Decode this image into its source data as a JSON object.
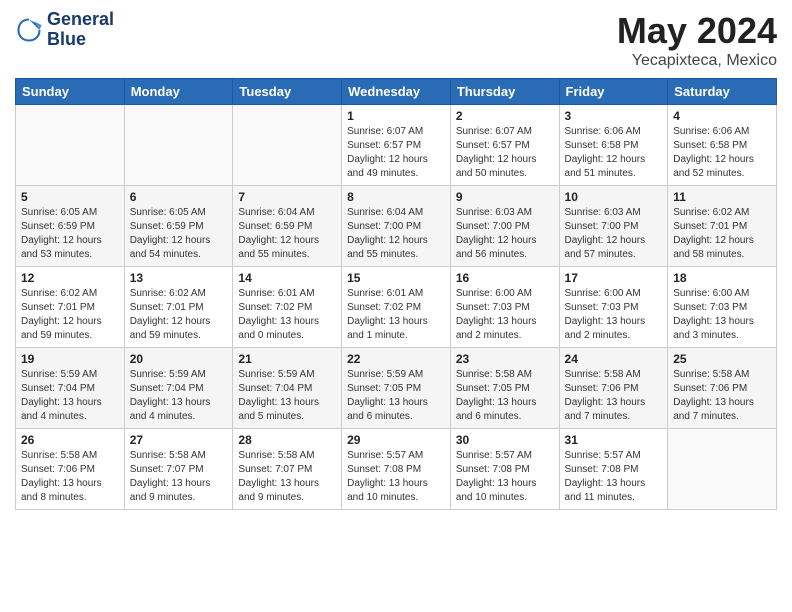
{
  "header": {
    "logo_line1": "General",
    "logo_line2": "Blue",
    "month": "May 2024",
    "location": "Yecapixteca, Mexico"
  },
  "weekdays": [
    "Sunday",
    "Monday",
    "Tuesday",
    "Wednesday",
    "Thursday",
    "Friday",
    "Saturday"
  ],
  "weeks": [
    [
      {
        "day": "",
        "info": ""
      },
      {
        "day": "",
        "info": ""
      },
      {
        "day": "",
        "info": ""
      },
      {
        "day": "1",
        "info": "Sunrise: 6:07 AM\nSunset: 6:57 PM\nDaylight: 12 hours\nand 49 minutes."
      },
      {
        "day": "2",
        "info": "Sunrise: 6:07 AM\nSunset: 6:57 PM\nDaylight: 12 hours\nand 50 minutes."
      },
      {
        "day": "3",
        "info": "Sunrise: 6:06 AM\nSunset: 6:58 PM\nDaylight: 12 hours\nand 51 minutes."
      },
      {
        "day": "4",
        "info": "Sunrise: 6:06 AM\nSunset: 6:58 PM\nDaylight: 12 hours\nand 52 minutes."
      }
    ],
    [
      {
        "day": "5",
        "info": "Sunrise: 6:05 AM\nSunset: 6:59 PM\nDaylight: 12 hours\nand 53 minutes."
      },
      {
        "day": "6",
        "info": "Sunrise: 6:05 AM\nSunset: 6:59 PM\nDaylight: 12 hours\nand 54 minutes."
      },
      {
        "day": "7",
        "info": "Sunrise: 6:04 AM\nSunset: 6:59 PM\nDaylight: 12 hours\nand 55 minutes."
      },
      {
        "day": "8",
        "info": "Sunrise: 6:04 AM\nSunset: 7:00 PM\nDaylight: 12 hours\nand 55 minutes."
      },
      {
        "day": "9",
        "info": "Sunrise: 6:03 AM\nSunset: 7:00 PM\nDaylight: 12 hours\nand 56 minutes."
      },
      {
        "day": "10",
        "info": "Sunrise: 6:03 AM\nSunset: 7:00 PM\nDaylight: 12 hours\nand 57 minutes."
      },
      {
        "day": "11",
        "info": "Sunrise: 6:02 AM\nSunset: 7:01 PM\nDaylight: 12 hours\nand 58 minutes."
      }
    ],
    [
      {
        "day": "12",
        "info": "Sunrise: 6:02 AM\nSunset: 7:01 PM\nDaylight: 12 hours\nand 59 minutes."
      },
      {
        "day": "13",
        "info": "Sunrise: 6:02 AM\nSunset: 7:01 PM\nDaylight: 12 hours\nand 59 minutes."
      },
      {
        "day": "14",
        "info": "Sunrise: 6:01 AM\nSunset: 7:02 PM\nDaylight: 13 hours\nand 0 minutes."
      },
      {
        "day": "15",
        "info": "Sunrise: 6:01 AM\nSunset: 7:02 PM\nDaylight: 13 hours\nand 1 minute."
      },
      {
        "day": "16",
        "info": "Sunrise: 6:00 AM\nSunset: 7:03 PM\nDaylight: 13 hours\nand 2 minutes."
      },
      {
        "day": "17",
        "info": "Sunrise: 6:00 AM\nSunset: 7:03 PM\nDaylight: 13 hours\nand 2 minutes."
      },
      {
        "day": "18",
        "info": "Sunrise: 6:00 AM\nSunset: 7:03 PM\nDaylight: 13 hours\nand 3 minutes."
      }
    ],
    [
      {
        "day": "19",
        "info": "Sunrise: 5:59 AM\nSunset: 7:04 PM\nDaylight: 13 hours\nand 4 minutes."
      },
      {
        "day": "20",
        "info": "Sunrise: 5:59 AM\nSunset: 7:04 PM\nDaylight: 13 hours\nand 4 minutes."
      },
      {
        "day": "21",
        "info": "Sunrise: 5:59 AM\nSunset: 7:04 PM\nDaylight: 13 hours\nand 5 minutes."
      },
      {
        "day": "22",
        "info": "Sunrise: 5:59 AM\nSunset: 7:05 PM\nDaylight: 13 hours\nand 6 minutes."
      },
      {
        "day": "23",
        "info": "Sunrise: 5:58 AM\nSunset: 7:05 PM\nDaylight: 13 hours\nand 6 minutes."
      },
      {
        "day": "24",
        "info": "Sunrise: 5:58 AM\nSunset: 7:06 PM\nDaylight: 13 hours\nand 7 minutes."
      },
      {
        "day": "25",
        "info": "Sunrise: 5:58 AM\nSunset: 7:06 PM\nDaylight: 13 hours\nand 7 minutes."
      }
    ],
    [
      {
        "day": "26",
        "info": "Sunrise: 5:58 AM\nSunset: 7:06 PM\nDaylight: 13 hours\nand 8 minutes."
      },
      {
        "day": "27",
        "info": "Sunrise: 5:58 AM\nSunset: 7:07 PM\nDaylight: 13 hours\nand 9 minutes."
      },
      {
        "day": "28",
        "info": "Sunrise: 5:58 AM\nSunset: 7:07 PM\nDaylight: 13 hours\nand 9 minutes."
      },
      {
        "day": "29",
        "info": "Sunrise: 5:57 AM\nSunset: 7:08 PM\nDaylight: 13 hours\nand 10 minutes."
      },
      {
        "day": "30",
        "info": "Sunrise: 5:57 AM\nSunset: 7:08 PM\nDaylight: 13 hours\nand 10 minutes."
      },
      {
        "day": "31",
        "info": "Sunrise: 5:57 AM\nSunset: 7:08 PM\nDaylight: 13 hours\nand 11 minutes."
      },
      {
        "day": "",
        "info": ""
      }
    ]
  ]
}
